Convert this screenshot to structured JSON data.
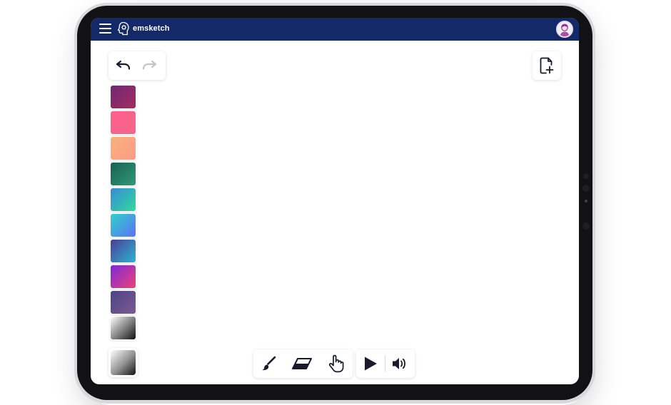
{
  "app": {
    "title": "emsketch",
    "brand_color": "#132968"
  },
  "header": {
    "menu_icon": "hamburger-menu-icon",
    "logo_icon": "head-logo-icon",
    "avatar_icon": "user-avatar-icon"
  },
  "history": {
    "undo_icon": "undo-icon",
    "redo_icon": "redo-icon",
    "redo_enabled": false
  },
  "document": {
    "new_page_icon": "new-page-icon"
  },
  "palette": {
    "swatches": [
      {
        "from": "#6d2c75",
        "to": "#a6295f"
      },
      {
        "from": "#ff5f8c",
        "to": "#f3668c"
      },
      {
        "from": "#f8b17c",
        "to": "#fe9a86"
      },
      {
        "from": "#1a5e56",
        "to": "#2f9c72"
      },
      {
        "from": "#3a8ad7",
        "to": "#2edc9b"
      },
      {
        "from": "#2fd3c8",
        "to": "#5b70f6"
      },
      {
        "from": "#4b3f95",
        "to": "#2bb3d4"
      },
      {
        "from": "#7b2ad9",
        "to": "#ee4277"
      },
      {
        "from": "#4c4488",
        "to": "#7d5a8f"
      },
      {
        "from": "#ffffff",
        "to": "#111111"
      }
    ],
    "selected": {
      "from": "#ffffff",
      "to": "#111111"
    }
  },
  "tools": {
    "brush_icon": "brush-icon",
    "eraser_icon": "eraser-icon",
    "hand_icon": "hand-pointer-icon",
    "play_icon": "play-icon",
    "sound_icon": "volume-icon"
  }
}
